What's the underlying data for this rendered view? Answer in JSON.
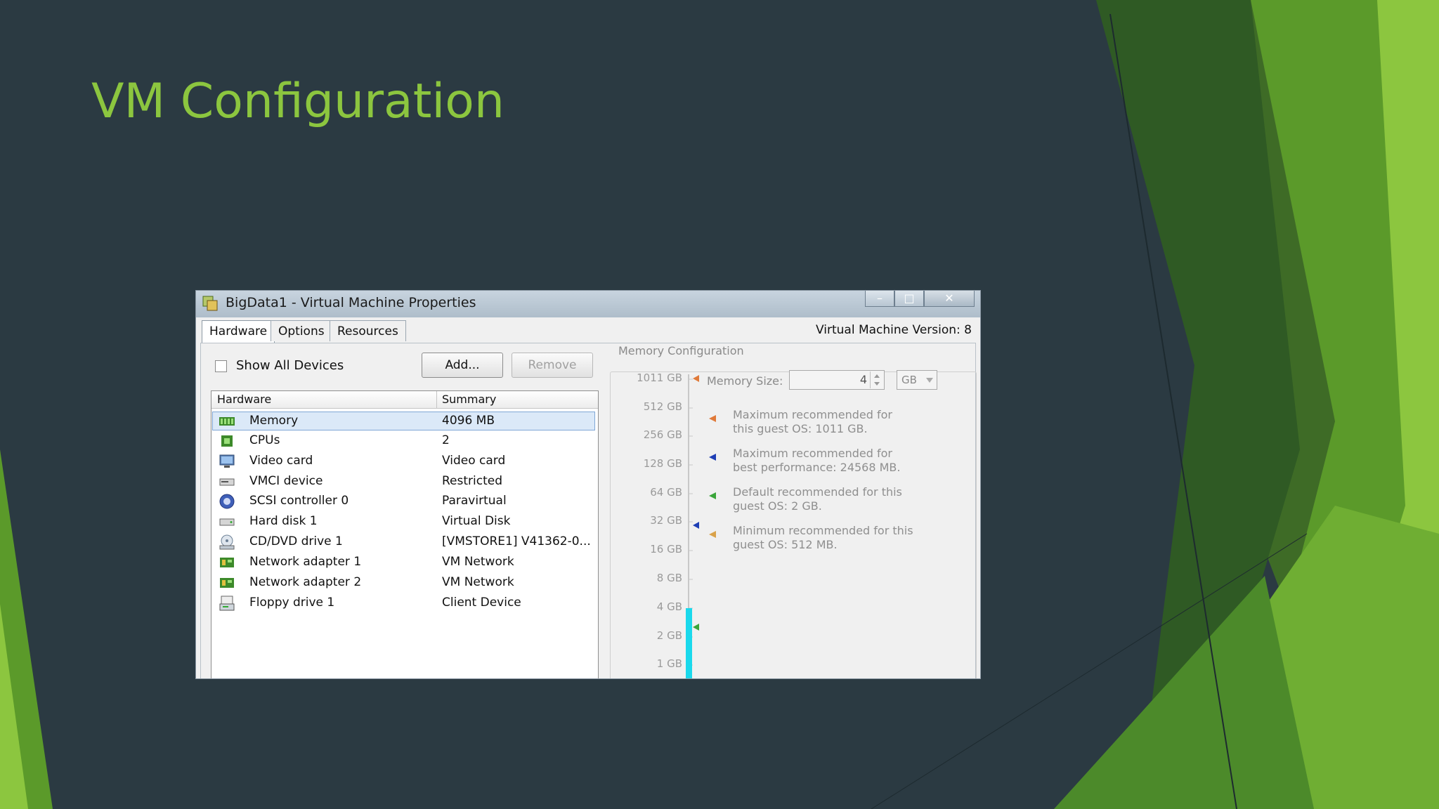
{
  "slide": {
    "title": "VM Configuration"
  },
  "window": {
    "title": "BigData1 - Virtual Machine Properties",
    "minimize": "–",
    "maximize": "□",
    "close": "✕"
  },
  "tabs": [
    {
      "label": "Hardware",
      "active": true
    },
    {
      "label": "Options",
      "active": false
    },
    {
      "label": "Resources",
      "active": false
    }
  ],
  "vm_version": "Virtual Machine Version: 8",
  "controls": {
    "show_all_devices": "Show All Devices",
    "show_all_checked": false,
    "add": "Add...",
    "remove": "Remove"
  },
  "hardware_table": {
    "columns": [
      "Hardware",
      "Summary"
    ],
    "rows": [
      {
        "icon": "memory-icon",
        "name": "Memory",
        "summary": "4096 MB",
        "selected": true
      },
      {
        "icon": "cpu-icon",
        "name": "CPUs",
        "summary": "2"
      },
      {
        "icon": "monitor-icon",
        "name": "Video card",
        "summary": "Video card"
      },
      {
        "icon": "device-icon",
        "name": "VMCI device",
        "summary": "Restricted"
      },
      {
        "icon": "scsi-icon",
        "name": "SCSI controller 0",
        "summary": "Paravirtual"
      },
      {
        "icon": "disk-icon",
        "name": "Hard disk 1",
        "summary": "Virtual Disk"
      },
      {
        "icon": "cd-icon",
        "name": "CD/DVD drive 1",
        "summary": "[VMSTORE1] V41362-0..."
      },
      {
        "icon": "network-icon",
        "name": "Network adapter 1",
        "summary": "VM Network"
      },
      {
        "icon": "network-icon",
        "name": "Network adapter 2",
        "summary": "VM Network"
      },
      {
        "icon": "floppy-icon",
        "name": "Floppy drive 1",
        "summary": "Client Device"
      }
    ]
  },
  "memory_config": {
    "legend": "Memory Configuration",
    "scale": [
      "1011 GB",
      "512 GB",
      "256 GB",
      "128 GB",
      "64 GB",
      "32 GB",
      "16 GB",
      "8 GB",
      "4 GB",
      "2 GB",
      "1 GB"
    ],
    "size_label": "Memory Size:",
    "size_value": "4",
    "unit": "GB",
    "notes": [
      {
        "text": "Maximum recommended for this guest OS: 1011 GB.",
        "color": "#e07a3a"
      },
      {
        "text": "Maximum recommended for best performance: 24568 MB.",
        "color": "#1f3fb5"
      },
      {
        "text": "Default recommended for this guest OS: 2 GB.",
        "color": "#3aa53a"
      },
      {
        "text": "Minimum recommended for this guest OS: 512 MB.",
        "color": "#d9a24a"
      }
    ]
  },
  "colors": {
    "title": "#8cc63f",
    "background": "#2b3a42",
    "memory_bar": "#1ad9ec"
  }
}
